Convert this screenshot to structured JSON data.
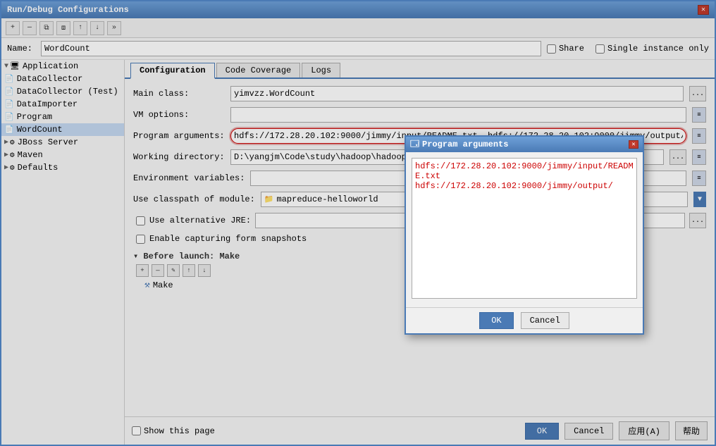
{
  "window": {
    "title": "Run/Debug Configurations",
    "close_label": "✕"
  },
  "toolbar": {
    "add_label": "+",
    "remove_label": "—",
    "copy_label": "⧉",
    "share_label": "⧈",
    "up_label": "↑",
    "down_label": "↓",
    "more_label": "»"
  },
  "name_row": {
    "label": "Name:",
    "value": "WordCount",
    "share_label": "Share",
    "single_instance_label": "Single instance only"
  },
  "sidebar": {
    "items": [
      {
        "id": "application",
        "label": "Application",
        "indent": 0,
        "arrow": "▼",
        "icon": "🖥",
        "selected": false
      },
      {
        "id": "datacollector",
        "label": "DataCollector",
        "indent": 1,
        "icon": "📄",
        "selected": false
      },
      {
        "id": "datacollector-test",
        "label": "DataCollector (Test)",
        "indent": 1,
        "icon": "📄",
        "selected": false
      },
      {
        "id": "dataimporter",
        "label": "DataImporter",
        "indent": 1,
        "icon": "📄",
        "selected": false
      },
      {
        "id": "program",
        "label": "Program",
        "indent": 1,
        "icon": "📄",
        "selected": false
      },
      {
        "id": "wordcount",
        "label": "WordCount",
        "indent": 1,
        "icon": "📄",
        "selected": true
      },
      {
        "id": "jboss",
        "label": "JBoss Server",
        "indent": 0,
        "arrow": "▶",
        "icon": "⚙",
        "selected": false
      },
      {
        "id": "maven",
        "label": "Maven",
        "indent": 0,
        "arrow": "▶",
        "icon": "⚙",
        "selected": false
      },
      {
        "id": "defaults",
        "label": "Defaults",
        "indent": 0,
        "arrow": "▶",
        "icon": "⚙",
        "selected": false
      }
    ]
  },
  "tabs": [
    {
      "id": "configuration",
      "label": "Configuration",
      "active": true
    },
    {
      "id": "code-coverage",
      "label": "Code Coverage",
      "active": false
    },
    {
      "id": "logs",
      "label": "Logs",
      "active": false
    }
  ],
  "config": {
    "main_class_label": "Main class:",
    "main_class_value": "yimvzz.WordCount",
    "vm_options_label": "VM options:",
    "vm_options_value": "",
    "program_args_label": "Program arguments:",
    "program_args_value": "hdfs://172.28.20.102:9000/jimmy/input/README.txt  hdfs://172.28.20.102:9000/jimmy/output/",
    "working_dir_label": "Working directory:",
    "working_dir_value": "D:\\yangjm\\Code\\study\\hadoop\\hadoop-2.6.0",
    "env_vars_label": "Environment variables:",
    "env_vars_value": "",
    "use_classpath_label": "Use classpath of module:",
    "use_classpath_value": "mapreduce-helloworld",
    "use_jre_label": "Use alternative JRE:",
    "use_jre_value": "",
    "enable_capturing_label": "Enable capturing form snapshots",
    "before_launch_label": "▾ Before launch: Make",
    "make_label": "Make"
  },
  "dialog": {
    "title": "Program arguments",
    "close_label": "✕",
    "content": "hdfs://172.28.20.102:9000/jimmy/input/README.txt\nhdfs://172.28.20.102:9000/jimmy/output/",
    "ok_label": "OK",
    "cancel_label": "Cancel"
  },
  "bottom": {
    "show_page_label": "Show this page",
    "ok_label": "OK",
    "cancel_label": "Cancel",
    "apply_label": "应用(A)",
    "help_label": "帮助"
  }
}
